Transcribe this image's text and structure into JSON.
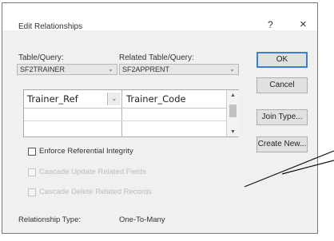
{
  "dialog": {
    "title": "Edit Relationships",
    "help_label": "?",
    "close_label": "×"
  },
  "table": {
    "label": "Table/Query:",
    "value": "SF2TRAINER"
  },
  "related_table": {
    "label": "Related Table/Query:",
    "value": "SF2APPRENT"
  },
  "fields": {
    "left": "Trainer_Ref",
    "right": "Trainer_Code"
  },
  "buttons": {
    "ok": "OK",
    "cancel": "Cancel",
    "join_type": "Join Type...",
    "create_new": "Create New..."
  },
  "options": {
    "enforce_integrity": "Enforce Referential Integrity",
    "cascade_update": "Cascade Update Related Fields",
    "cascade_delete": "Cascade Delete Related Records"
  },
  "relationship": {
    "type_label": "Relationship Type:",
    "type_value": "One-To-Many"
  }
}
